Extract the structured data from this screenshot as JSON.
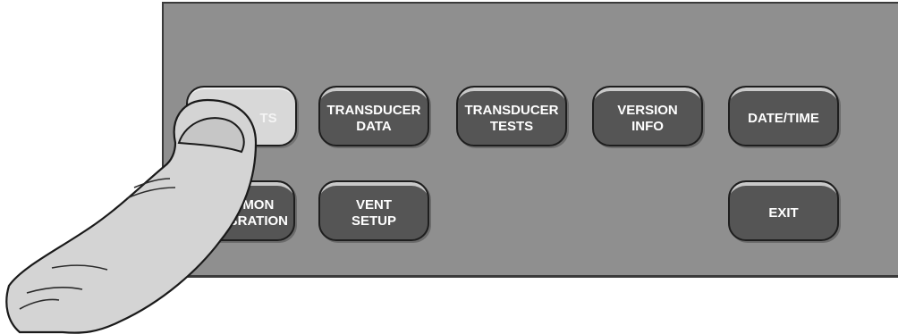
{
  "panel": {
    "buttons": [
      {
        "label": "TS"
      },
      {
        "label": "TRANSDUCER\nDATA"
      },
      {
        "label": "TRANSDUCER\nTESTS"
      },
      {
        "label": "VERSION\nINFO"
      },
      {
        "label": "DATE/TIME"
      },
      {
        "label": "E MON\nLIBRATION"
      },
      {
        "label": "VENT\nSETUP"
      },
      {
        "label": "EXIT"
      }
    ]
  },
  "colors": {
    "panel_bg": "#8f8f8f",
    "button_bg": "#555555",
    "button_pressed_bg": "#d8d8d8",
    "button_text": "#ffffff",
    "finger_fill": "#d4d4d4"
  },
  "icons": {
    "pointer": "pointing-finger-icon"
  }
}
